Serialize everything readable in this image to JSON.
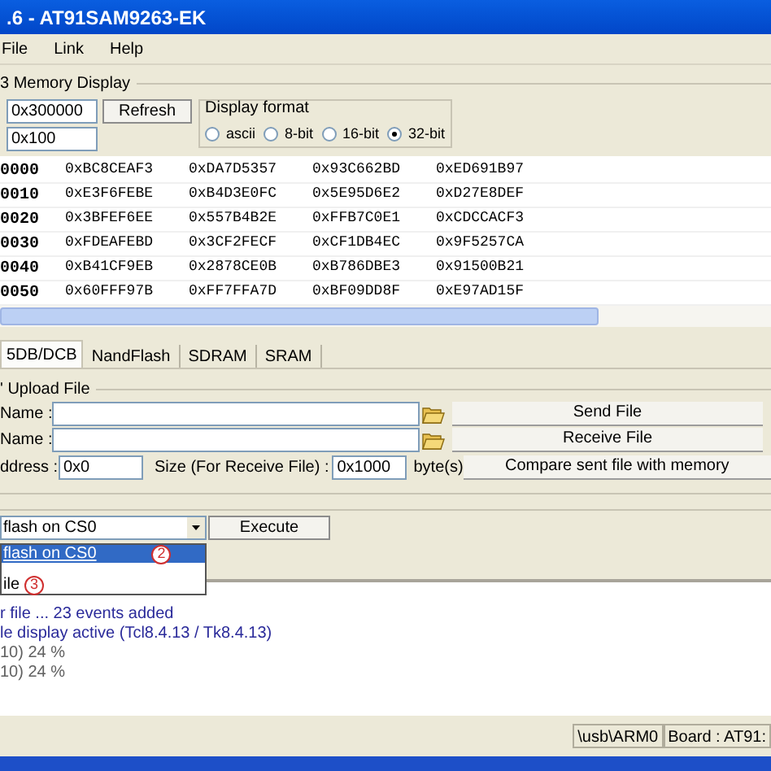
{
  "window": {
    "title": ".6 - AT91SAM9263-EK"
  },
  "menu": [
    "File",
    "Link",
    "Help"
  ],
  "memory_display": {
    "title": "3 Memory Display",
    "address": "0x300000",
    "size": "0x100",
    "refresh_button": "Refresh",
    "display_format": {
      "title": "Display format",
      "options": [
        {
          "label": "ascii",
          "selected": false
        },
        {
          "label": "8-bit",
          "selected": false
        },
        {
          "label": "16-bit",
          "selected": false
        },
        {
          "label": "32-bit",
          "selected": true
        }
      ]
    },
    "rows": [
      {
        "address": "0000",
        "values": [
          "0xBC8CEAF3",
          "0xDA7D5357",
          "0x93C662BD",
          "0xED691B97"
        ]
      },
      {
        "address": "0010",
        "values": [
          "0xE3F6FEBE",
          "0xB4D3E0FC",
          "0x5E95D6E2",
          "0xD27E8DEF"
        ]
      },
      {
        "address": "0020",
        "values": [
          "0x3BFEF6EE",
          "0x557B4B2E",
          "0xFFB7C0E1",
          "0xCDCCACF3"
        ]
      },
      {
        "address": "0030",
        "values": [
          "0xFDEAFEBD",
          "0x3CF2FECF",
          "0xCF1DB4EC",
          "0x9F5257CA"
        ]
      },
      {
        "address": "0040",
        "values": [
          "0xB41CF9EB",
          "0x2878CE0B",
          "0xB786DBE3",
          "0x91500B21"
        ]
      },
      {
        "address": "0050",
        "values": [
          "0x60FFF97B",
          "0xFF7FFA7D",
          "0xBF09DD8F",
          "0xE97AD15F"
        ]
      }
    ]
  },
  "tabs": [
    {
      "label": "5DB/DCB",
      "selected": true
    },
    {
      "label": "NandFlash",
      "selected": false
    },
    {
      "label": "SDRAM",
      "selected": false
    },
    {
      "label": "SRAM",
      "selected": false
    }
  ],
  "upload_file": {
    "title": "' Upload File",
    "send_name_label": "Name :",
    "receive_name_label": "Name :",
    "send_button": "Send File",
    "receive_button": "Receive File",
    "address_label": "ddress :",
    "address": "0x0",
    "size_label": "Size (For Receive File) :",
    "size": "0x1000",
    "size_unit": "byte(s)",
    "compare_button": "Compare sent file with memory"
  },
  "script": {
    "value": "flash on CS0",
    "execute_button": "Execute",
    "dropdown_items": [
      {
        "label": "flash on CS0",
        "selected": true,
        "annotation": "2"
      },
      {
        "label": "ile",
        "selected": false,
        "annotation": "3"
      }
    ]
  },
  "log": [
    {
      "text": "r file ... 23 events added",
      "kind": "info"
    },
    {
      "text": "le display active (Tcl8.4.13 / Tk8.4.13)",
      "kind": "info"
    },
    {
      "text": "10) 24 %",
      "kind": "progress"
    },
    {
      "text": "10) 24 %",
      "kind": "progress"
    }
  ],
  "status_bar": [
    "\\usb\\ARM0",
    "Board : AT91:"
  ]
}
